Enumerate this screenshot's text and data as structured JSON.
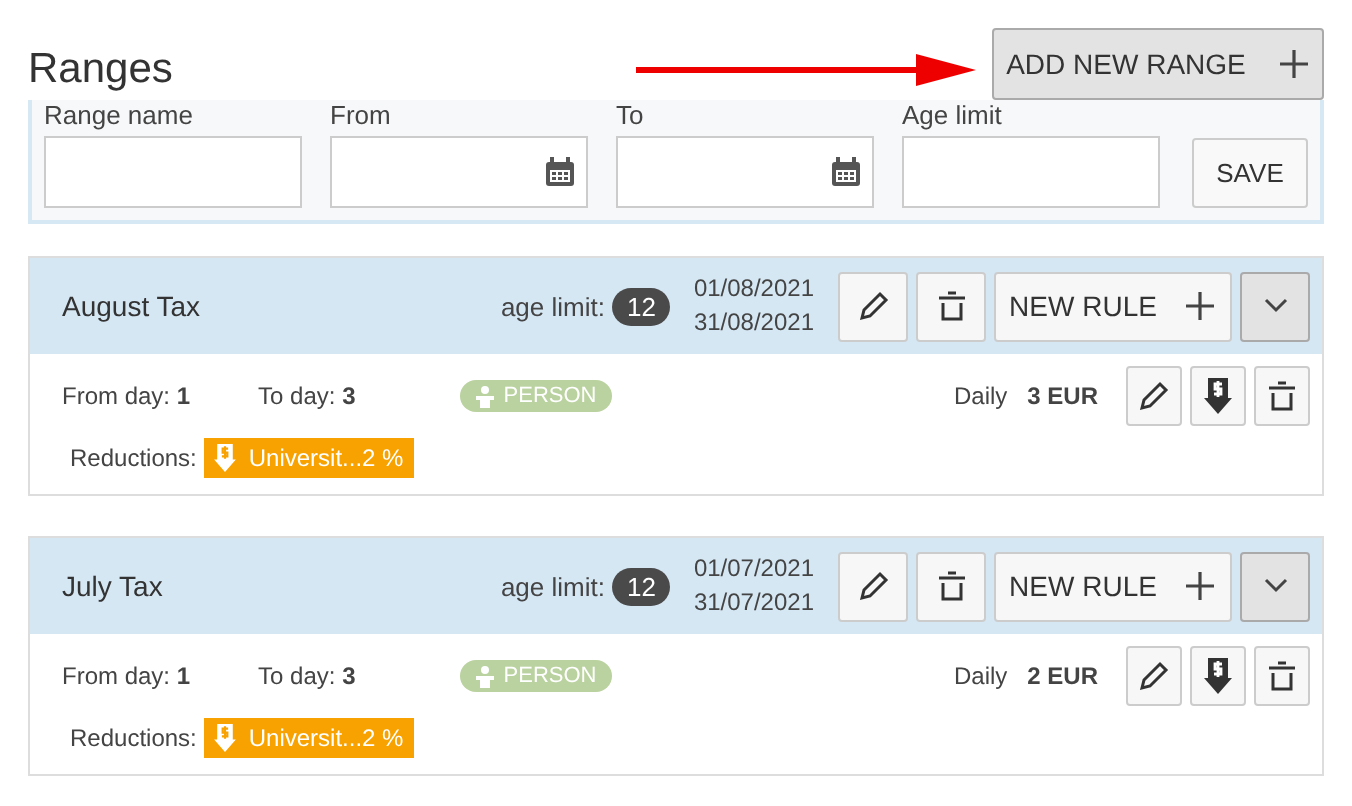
{
  "title": "Ranges",
  "add_button": {
    "label": "ADD NEW RANGE"
  },
  "form": {
    "fields": [
      {
        "label": "Range name",
        "kind": "text"
      },
      {
        "label": "From",
        "kind": "date"
      },
      {
        "label": "To",
        "kind": "date"
      },
      {
        "label": "Age limit",
        "kind": "text"
      }
    ],
    "save_button": "SAVE"
  },
  "ranges": [
    {
      "name": "August Tax",
      "age_label": "age limit:",
      "age": "12",
      "date_from": "01/08/2021",
      "date_to": "31/08/2021",
      "new_rule_button": "NEW RULE",
      "rules": [
        {
          "from_label": "From day:",
          "from": "1",
          "to_label": "To day:",
          "to": "3",
          "tag": "PERSON",
          "period": "Daily",
          "amount": "3 EUR",
          "reductions_label": "Reductions:",
          "reductions": [
            "Universit...2 %"
          ]
        }
      ]
    },
    {
      "name": "July Tax",
      "age_label": "age limit:",
      "age": "12",
      "date_from": "01/07/2021",
      "date_to": "31/07/2021",
      "new_rule_button": "NEW RULE",
      "rules": [
        {
          "from_label": "From day:",
          "from": "1",
          "to_label": "To day:",
          "to": "3",
          "tag": "PERSON",
          "period": "Daily",
          "amount": "2 EUR",
          "reductions_label": "Reductions:",
          "reductions": [
            "Universit...2 %"
          ]
        }
      ]
    }
  ]
}
